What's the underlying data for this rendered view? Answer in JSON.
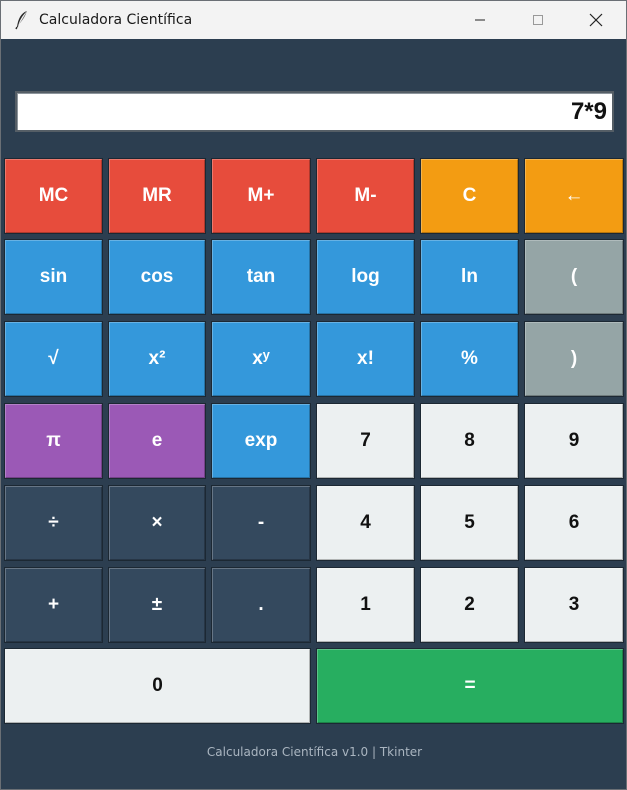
{
  "window": {
    "title": "Calculadora Científica"
  },
  "display": {
    "value": "7*9"
  },
  "buttons": {
    "mc": "MC",
    "mr": "MR",
    "mplus": "M+",
    "mminus": "M-",
    "clear": "C",
    "backspace": "←",
    "sin": "sin",
    "cos": "cos",
    "tan": "tan",
    "log": "log",
    "ln": "ln",
    "lparen": "(",
    "sqrt": "√",
    "square": "x²",
    "power": "xʸ",
    "factorial": "x!",
    "percent": "%",
    "rparen": ")",
    "pi": "π",
    "e": "e",
    "exp": "exp",
    "d7": "7",
    "d8": "8",
    "d9": "9",
    "divide": "÷",
    "multiply": "×",
    "minus": "-",
    "d4": "4",
    "d5": "5",
    "d6": "6",
    "plus": "+",
    "plusminus": "±",
    "dot": ".",
    "d1": "1",
    "d2": "2",
    "d3": "3",
    "d0": "0",
    "equals": "="
  },
  "colors": {
    "background": "#2c3e50",
    "memory": "#e74c3c",
    "clear": "#f39c12",
    "function": "#3498db",
    "paren": "#95a5a6",
    "constant": "#9b59b6",
    "operator": "#34495e",
    "digit": "#ecf0f1",
    "equals": "#27ae60"
  },
  "footer": {
    "text": "Calculadora Científica v1.0 | Tkinter"
  }
}
